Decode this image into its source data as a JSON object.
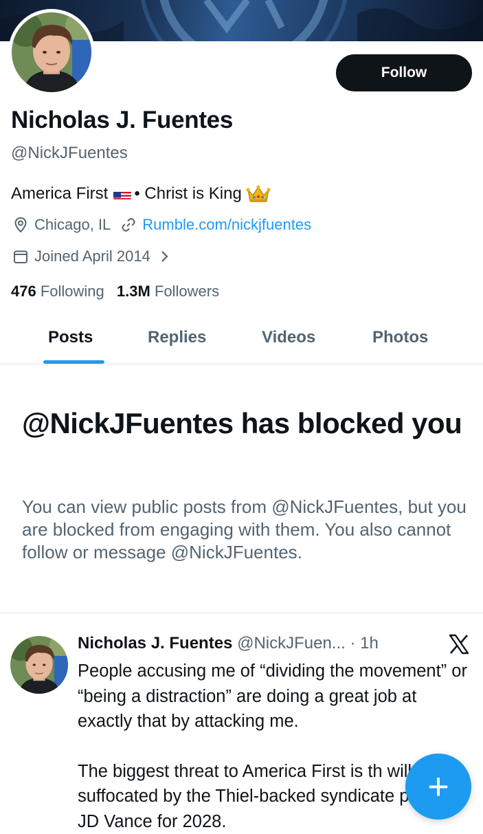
{
  "profile": {
    "name": "Nicholas J. Fuentes",
    "handle": "@NickJFuentes",
    "bio_part1": "America First",
    "bio_part2": "• Christ is King",
    "location": "Chicago, IL",
    "website": "Rumble.com/nickjfuentes",
    "joined": "Joined April 2014",
    "following_count": "476",
    "following_label": "Following",
    "followers_count": "1.3M",
    "followers_label": "Followers",
    "follow_button": "Follow"
  },
  "tabs": [
    {
      "label": "Posts",
      "active": true
    },
    {
      "label": "Replies",
      "active": false
    },
    {
      "label": "Videos",
      "active": false
    },
    {
      "label": "Photos",
      "active": false
    }
  ],
  "blocked": {
    "title": "@NickJFuentes has blocked you",
    "body": "You can view public posts from @NickJFuentes, but you are blocked from engaging with them. You also cannot follow or message @NickJFuentes."
  },
  "post": {
    "author": "Nicholas J. Fuentes",
    "meta": "@NickJFuen... · 1h",
    "paragraph1": "People accusing me of “dividing the movement” or “being a distraction” are doing a great job at exactly that by attacking me.",
    "paragraph2": "The biggest threat to America First is th will be suffocated by the Thiel-backed syndicate pushing JD Vance for 2028."
  },
  "fab": {
    "label": "+"
  },
  "icons": [
    "location-pin-icon",
    "link-icon",
    "calendar-icon",
    "chevron-right-icon",
    "us-flag-icon",
    "crown-icon",
    "x-logo-icon",
    "compose-plus-icon"
  ],
  "colors": {
    "accent": "#1d9bf0",
    "text": "#0f1419",
    "secondary": "#536471",
    "button": "#0f1419"
  }
}
